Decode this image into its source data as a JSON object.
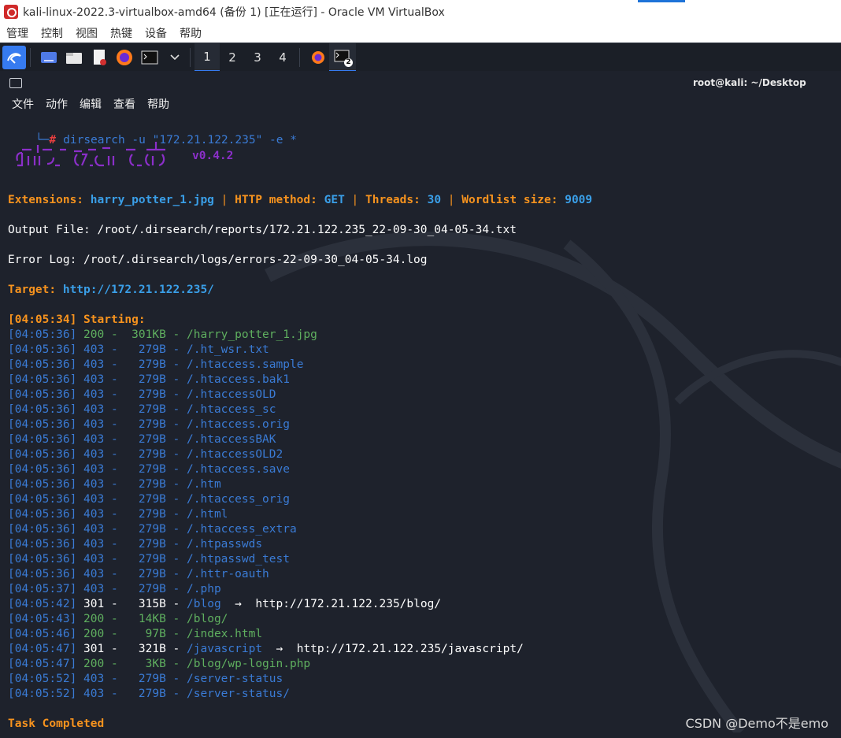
{
  "window": {
    "title": "kali-linux-2022.3-virtualbox-amd64 (备份 1) [正在运行] - Oracle VM VirtualBox"
  },
  "vbox_menu": [
    "管理",
    "控制",
    "视图",
    "热键",
    "设备",
    "帮助"
  ],
  "panel": {
    "workspaces": [
      "1",
      "2",
      "3",
      "4"
    ],
    "terminal_badge": "2"
  },
  "terminal": {
    "title": "root@kali: ~/Desktop",
    "menu": [
      "文件",
      "动作",
      "编辑",
      "查看",
      "帮助"
    ],
    "prompt_cmd": "dirsearch",
    "prompt_args": " -u \"172.21.122.235\" -e *",
    "version": "v0.4.2",
    "extensions_label": "Extensions:",
    "extensions_value": "harry_potter_1.jpg",
    "http_label": "HTTP method:",
    "http_value": "GET",
    "threads_label": "Threads:",
    "threads_value": "30",
    "wordlist_label": "Wordlist size:",
    "wordlist_value": "9009",
    "output_file": "Output File: /root/.dirsearch/reports/172.21.122.235_22-09-30_04-05-34.txt",
    "error_log": "Error Log: /root/.dirsearch/logs/errors-22-09-30_04-05-34.log",
    "target_label": "Target:",
    "target_value": "http://172.21.122.235/",
    "starting": "[04:05:34] Starting:",
    "results": [
      {
        "time": "[04:05:36]",
        "code": "200",
        "size": "301KB",
        "path": "/harry_potter_1.jpg",
        "redirect": ""
      },
      {
        "time": "[04:05:36]",
        "code": "403",
        "size": "279B",
        "path": "/.ht_wsr.txt",
        "redirect": ""
      },
      {
        "time": "[04:05:36]",
        "code": "403",
        "size": "279B",
        "path": "/.htaccess.sample",
        "redirect": ""
      },
      {
        "time": "[04:05:36]",
        "code": "403",
        "size": "279B",
        "path": "/.htaccess.bak1",
        "redirect": ""
      },
      {
        "time": "[04:05:36]",
        "code": "403",
        "size": "279B",
        "path": "/.htaccessOLD",
        "redirect": ""
      },
      {
        "time": "[04:05:36]",
        "code": "403",
        "size": "279B",
        "path": "/.htaccess_sc",
        "redirect": ""
      },
      {
        "time": "[04:05:36]",
        "code": "403",
        "size": "279B",
        "path": "/.htaccess.orig",
        "redirect": ""
      },
      {
        "time": "[04:05:36]",
        "code": "403",
        "size": "279B",
        "path": "/.htaccessBAK",
        "redirect": ""
      },
      {
        "time": "[04:05:36]",
        "code": "403",
        "size": "279B",
        "path": "/.htaccessOLD2",
        "redirect": ""
      },
      {
        "time": "[04:05:36]",
        "code": "403",
        "size": "279B",
        "path": "/.htaccess.save",
        "redirect": ""
      },
      {
        "time": "[04:05:36]",
        "code": "403",
        "size": "279B",
        "path": "/.htm",
        "redirect": ""
      },
      {
        "time": "[04:05:36]",
        "code": "403",
        "size": "279B",
        "path": "/.htaccess_orig",
        "redirect": ""
      },
      {
        "time": "[04:05:36]",
        "code": "403",
        "size": "279B",
        "path": "/.html",
        "redirect": ""
      },
      {
        "time": "[04:05:36]",
        "code": "403",
        "size": "279B",
        "path": "/.htaccess_extra",
        "redirect": ""
      },
      {
        "time": "[04:05:36]",
        "code": "403",
        "size": "279B",
        "path": "/.htpasswds",
        "redirect": ""
      },
      {
        "time": "[04:05:36]",
        "code": "403",
        "size": "279B",
        "path": "/.htpasswd_test",
        "redirect": ""
      },
      {
        "time": "[04:05:36]",
        "code": "403",
        "size": "279B",
        "path": "/.httr-oauth",
        "redirect": ""
      },
      {
        "time": "[04:05:37]",
        "code": "403",
        "size": "279B",
        "path": "/.php",
        "redirect": ""
      },
      {
        "time": "[04:05:42]",
        "code": "301",
        "size": "315B",
        "path": "/blog",
        "redirect": "http://172.21.122.235/blog/"
      },
      {
        "time": "[04:05:43]",
        "code": "200",
        "size": "14KB",
        "path": "/blog/",
        "redirect": ""
      },
      {
        "time": "[04:05:46]",
        "code": "200",
        "size": "97B",
        "path": "/index.html",
        "redirect": ""
      },
      {
        "time": "[04:05:47]",
        "code": "301",
        "size": "321B",
        "path": "/javascript",
        "redirect": "http://172.21.122.235/javascript/"
      },
      {
        "time": "[04:05:47]",
        "code": "200",
        "size": "3KB",
        "path": "/blog/wp-login.php",
        "redirect": ""
      },
      {
        "time": "[04:05:52]",
        "code": "403",
        "size": "279B",
        "path": "/server-status",
        "redirect": ""
      },
      {
        "time": "[04:05:52]",
        "code": "403",
        "size": "279B",
        "path": "/server-status/",
        "redirect": ""
      }
    ],
    "completed": "Task Completed"
  },
  "watermark": "CSDN @Demo不是emo",
  "colors": {
    "orange": "#f7931e",
    "blue_bold": "#3a9fe8",
    "blue": "#3a7bd5",
    "green": "#5faf5f",
    "purple": "#8b2fc9",
    "terminal_bg": "#1e222c",
    "panel_bg": "#1b1f27"
  }
}
